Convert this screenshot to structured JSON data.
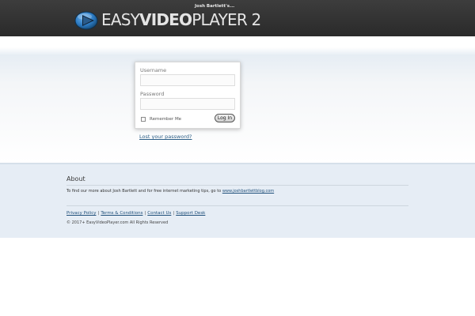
{
  "header": {
    "tagline": "Josh Bartlett's...",
    "logo_part1": "EASY",
    "logo_part2": "VIDEO",
    "logo_part3": "PLAYER 2",
    "colors": {
      "background": "#2f2f2f",
      "logo_blue": "#2f7fc4"
    }
  },
  "login": {
    "username_label": "Username",
    "username_value": "",
    "password_label": "Password",
    "password_value": "",
    "remember_label": "Remember Me",
    "remember_checked": false,
    "login_button": "Log In",
    "lost_password": "Lost your password?"
  },
  "footer": {
    "about_title": "About",
    "about_text": "To find our more about Josh Bartlett and for free internet marketing tips, go to ",
    "about_link": "www.joshbartlettblog.com",
    "links": [
      "Privacy Policy",
      "Terms & Conditions",
      "Contact Us",
      "Support Desk"
    ],
    "copyright": "© 2017+ EasyVideoPlayer.com All Rights Reserved",
    "colors": {
      "background": "#e6edf5",
      "link": "#1f4f7a"
    }
  }
}
